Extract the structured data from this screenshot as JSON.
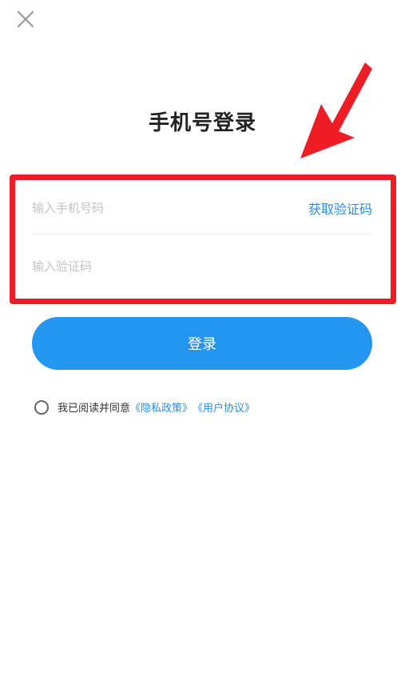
{
  "header": {
    "close_icon": "close-icon",
    "title": "手机号登录"
  },
  "form": {
    "phone_placeholder": "输入手机号码",
    "phone_value": "",
    "get_code_label": "获取验证码",
    "code_placeholder": "输入验证码",
    "code_value": ""
  },
  "login_button": {
    "label": "登录"
  },
  "agreement": {
    "prefix": "我已阅读并同意",
    "privacy_link": "《隐私政策》",
    "user_agreement_link": "《用户协议》",
    "checked": false
  },
  "colors": {
    "primary": "#2496f1",
    "link": "#2a8ce8",
    "annotation_red": "#ee1c25"
  }
}
